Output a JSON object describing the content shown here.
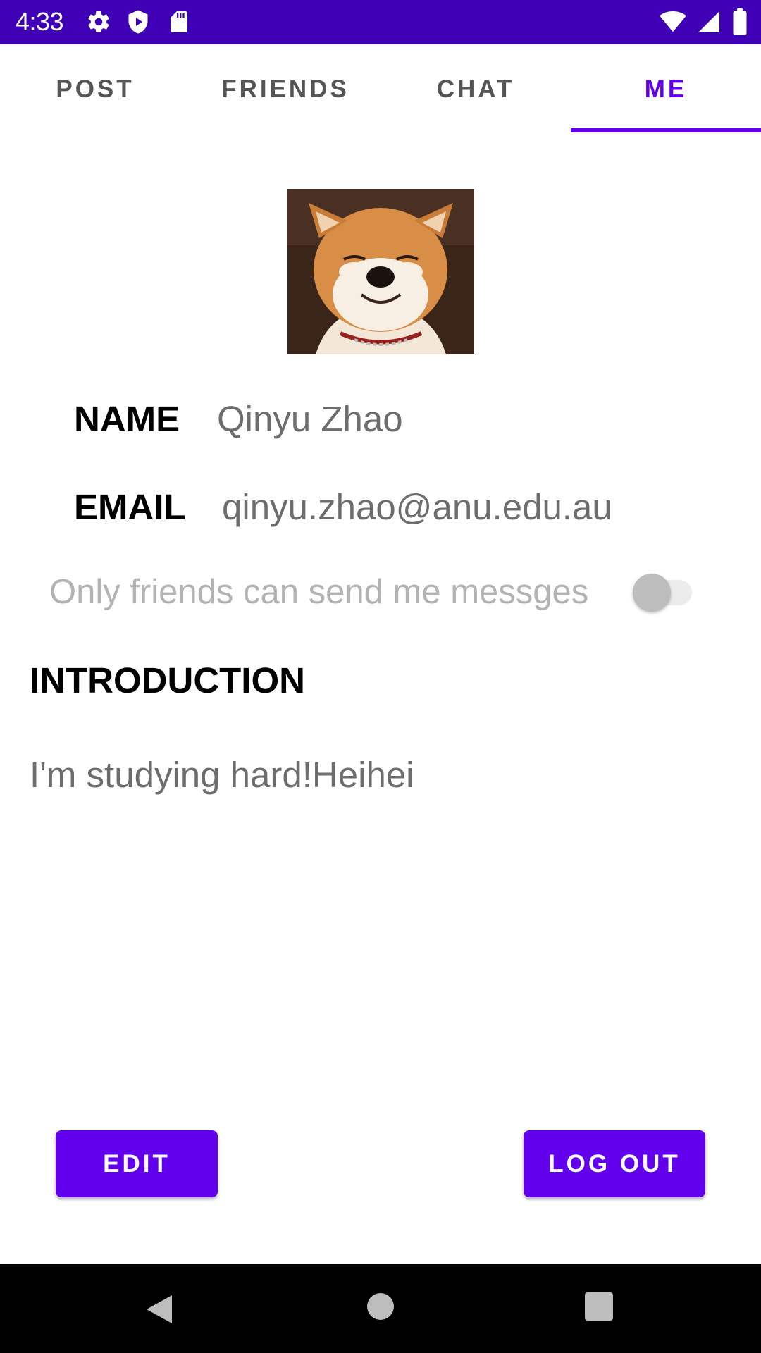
{
  "status_bar": {
    "time": "4:33",
    "icons_left": [
      "settings-icon",
      "shield-play-icon",
      "sd-card-icon"
    ],
    "icons_right": [
      "wifi-icon",
      "cellular-signal-icon",
      "battery-icon"
    ],
    "background": "#3f00b5"
  },
  "tabs": [
    {
      "label": "POST",
      "active": false
    },
    {
      "label": "FRIENDS",
      "active": false
    },
    {
      "label": "CHAT",
      "active": false
    },
    {
      "label": "ME",
      "active": true
    }
  ],
  "profile": {
    "avatar_description": "shiba-inu-avatar",
    "name_label": "NAME",
    "name_value": "Qinyu Zhao",
    "email_label": "EMAIL",
    "email_value": "qinyu.zhao@anu.edu.au",
    "toggle_label": "Only friends can send me messges",
    "toggle_on": false,
    "intro_heading": "INTRODUCTION",
    "intro_text": "I'm studying hard!Heihei"
  },
  "actions": {
    "edit_label": "EDIT",
    "logout_label": "LOG OUT"
  },
  "nav_bar": {
    "icons": [
      "back-icon",
      "home-icon",
      "recents-icon"
    ]
  },
  "colors": {
    "accent": "#6200ee",
    "status_bar": "#3f00b5"
  }
}
